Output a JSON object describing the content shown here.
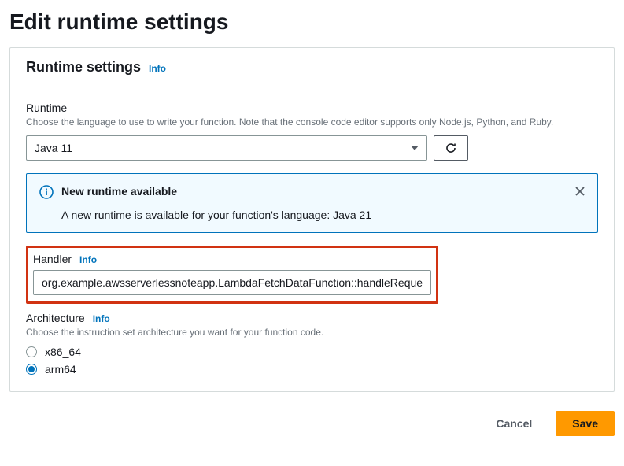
{
  "page": {
    "title": "Edit runtime settings"
  },
  "panel": {
    "title": "Runtime settings",
    "info_label": "Info"
  },
  "runtime": {
    "label": "Runtime",
    "description": "Choose the language to use to write your function. Note that the console code editor supports only Node.js, Python, and Ruby.",
    "selected": "Java 11"
  },
  "flash": {
    "title": "New runtime available",
    "body": "A new runtime is available for your function's language: Java 21"
  },
  "handler": {
    "label": "Handler",
    "info_label": "Info",
    "value": "org.example.awsserverlessnoteapp.LambdaFetchDataFunction::handleRequest"
  },
  "architecture": {
    "label": "Architecture",
    "info_label": "Info",
    "description": "Choose the instruction set architecture you want for your function code.",
    "options": [
      "x86_64",
      "arm64"
    ],
    "selected": "arm64"
  },
  "actions": {
    "cancel": "Cancel",
    "save": "Save"
  }
}
